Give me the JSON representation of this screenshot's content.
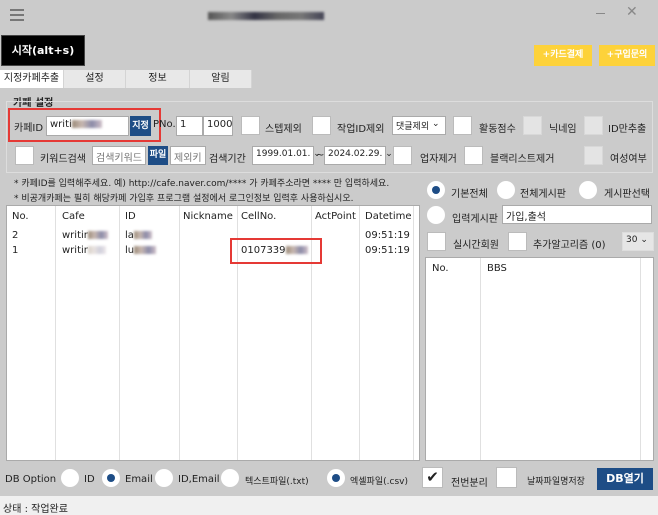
{
  "window": {
    "title": "",
    "menu_icon": "hamburger-icon",
    "minimize_icon": "minimize-icon",
    "close_icon": "close-icon"
  },
  "toolbar": {
    "start_label": "시작(alt+s)",
    "card_payment_label": "+카드결제",
    "purchase_inquiry_label": "+구입문의"
  },
  "tabs": [
    {
      "label": "지정카페추출",
      "active": true
    },
    {
      "label": "설정"
    },
    {
      "label": "정보"
    },
    {
      "label": "알림"
    }
  ],
  "cafe_settings": {
    "title": "카페 설정",
    "cafe_id_label": "카페ID",
    "cafe_id_value": "writi",
    "assign_label": "지정",
    "pno_label": "PNo.",
    "pno_from": "1",
    "pno_to": "1000",
    "exclude_staff_label": "스텝제외",
    "exclude_work_id_label": "작업ID제외",
    "work_id_select": "댓글제외",
    "activity_score_label": "활동점수",
    "nickname_label": "닉네임",
    "id_only_label": "ID만추출",
    "keyword_search_label": "키워드검색",
    "keyword_placeholder": "검색키워드",
    "file_label": "파일",
    "exclude_keyword_placeholder": "제외키",
    "search_period_label": "검색기간",
    "date_from": "1999.01.01.",
    "date_to": "2024.02.29.",
    "exclude_business_label": "업자제거",
    "exclude_blacklist_label": "블랙리스트제거",
    "female_label": "여성여부"
  },
  "notes": [
    "* 카페ID를 입력해주세요. 예) http://cafe.naver.com/**** 가 카페주소라면 **** 만 입력하세요.",
    "* 비공개카페는 필히 해당카페 가입후 프로그램 설정에서 로그인정보 입력후 사용하십시오."
  ],
  "results_table": {
    "columns": [
      "No.",
      "Cafe",
      "ID",
      "Nickname",
      "CellNo.",
      "ActPoint",
      "Datetime"
    ],
    "rows": [
      {
        "no": "2",
        "cafe": "writir",
        "id": "la",
        "nickname": "",
        "cellno": "",
        "actpoint": "",
        "datetime": "09:51:19"
      },
      {
        "no": "1",
        "cafe": "writir",
        "id": "lu",
        "nickname": "",
        "cellno": "0107339",
        "actpoint": "",
        "datetime": "09:51:19"
      }
    ]
  },
  "board_options": {
    "basic_all": "기본전체",
    "all_boards": "전체게시판",
    "select_board": "게시판선택",
    "input_board": "입력게시판",
    "input_board_value": "가입,출석",
    "realtime_members": "실시간회원",
    "extra_algorithm": "추가알고리즘 (0)",
    "count_select": "30",
    "selected": "basic_all"
  },
  "bbs_table": {
    "columns": [
      "No.",
      "BBS"
    ]
  },
  "db_option": {
    "label": "DB Option",
    "id": "ID",
    "email": "Email",
    "id_email": "ID,Email",
    "text_file": "텍스트파일(.txt)",
    "excel_file": "엑셀파일(.csv)",
    "split_label": "전번분리",
    "split_checked": true,
    "date_filename_label": "날짜파일명저장",
    "open_db_label": "DB열기",
    "selected_key": "Email",
    "selected_format": "csv"
  },
  "status": {
    "text": "상태 : 작업완료"
  },
  "colors": {
    "accent": "#1e4d86",
    "yellow": "#fdd23a",
    "highlight": "#e53935"
  }
}
